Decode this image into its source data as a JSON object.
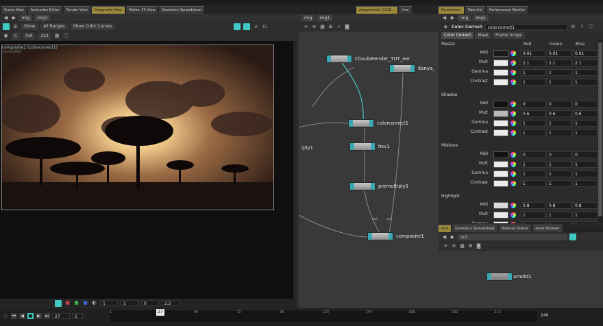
{
  "viewer": {
    "tabs": [
      "Scene View",
      "Animation Editor",
      "Render View",
      "Composite View",
      "Motion FX View",
      "Geometry Spreadsheet"
    ],
    "active_tab": 3,
    "path": "img1",
    "path_root": "img",
    "show_label": "Show",
    "range_label": "All Ranges",
    "channel": "C",
    "quality": "Full",
    "zoom_mode": "2x2",
    "curves_button": "Show Color Curves",
    "node_label": "composite1 (colorcorrect1)",
    "resolution": "1920x1080",
    "gamma_value": "1",
    "exposure_value": "1",
    "offset_value": "0",
    "display_gamma": "2.2"
  },
  "network": {
    "tabs": [
      "/shop/arnold_CLOU...",
      "/vex"
    ],
    "path_root": "img",
    "path": "img1",
    "nodes": [
      {
        "name": "CloudsRender_TUT_exr"
      },
      {
        "name": "Kenya_"
      },
      {
        "name": "colorcorrect1"
      },
      {
        "name": "hsv1"
      },
      {
        "name": "premultiply1"
      },
      {
        "name": "composite1"
      },
      {
        "name": "iply1"
      }
    ],
    "wire_labels": [
      "out",
      "out"
    ]
  },
  "params": {
    "tabs": [
      "Parameters",
      "Take List",
      "Performance Monitor"
    ],
    "path_root": "img",
    "path": "img1",
    "node_type": "Color Correct",
    "node_name": "colorcorrect1",
    "subtabs": [
      "Color Correct",
      "Mask",
      "Frame Scope"
    ],
    "columns": [
      "Red",
      "Green",
      "Blue"
    ],
    "groups": [
      {
        "name": "Master",
        "rows": [
          {
            "label": "Add",
            "swatch": "#1a1a1a",
            "values": [
              "0.01",
              "0.01",
              "0.01"
            ]
          },
          {
            "label": "Mult",
            "swatch": "#ececec",
            "values": [
              "2.1",
              "2.1",
              "2.1"
            ]
          },
          {
            "label": "Gamma",
            "swatch": "#ececec",
            "values": [
              "1",
              "1",
              "1"
            ]
          },
          {
            "label": "Contrast",
            "swatch": "#ececec",
            "values": [
              "1",
              "1",
              "1"
            ]
          }
        ]
      },
      {
        "name": "Shadow",
        "rows": [
          {
            "label": "Add",
            "swatch": "#111111",
            "values": [
              "0",
              "0",
              "0"
            ]
          },
          {
            "label": "Mult",
            "swatch": "#b8b8b8",
            "values": [
              "0.6",
              "0.6",
              "0.6"
            ]
          },
          {
            "label": "Gamma",
            "swatch": "#ececec",
            "values": [
              "1",
              "1",
              "1"
            ]
          },
          {
            "label": "Contrast",
            "swatch": "#ececec",
            "values": [
              "1",
              "1",
              "1"
            ]
          }
        ]
      },
      {
        "name": "Midtone",
        "rows": [
          {
            "label": "Add",
            "swatch": "#111111",
            "values": [
              "0",
              "0",
              "0"
            ]
          },
          {
            "label": "Mult",
            "swatch": "#ececec",
            "values": [
              "1",
              "1",
              "1"
            ]
          },
          {
            "label": "Gamma",
            "swatch": "#ececec",
            "values": [
              "1",
              "1",
              "1"
            ]
          },
          {
            "label": "Contrast",
            "swatch": "#ececec",
            "values": [
              "1",
              "1",
              "1"
            ]
          }
        ]
      },
      {
        "name": "Highlight",
        "rows": [
          {
            "label": "Add",
            "swatch": "#d8d8d8",
            "values": [
              "0.8",
              "0.8",
              "0.8"
            ]
          },
          {
            "label": "Mult",
            "swatch": "#ececec",
            "values": [
              "1",
              "1",
              "1"
            ]
          },
          {
            "label": "Gamma",
            "swatch": "#ececec",
            "values": [
              "1",
              "1",
              "1"
            ]
          },
          {
            "label": "Contrast",
            "swatch": "#ececec",
            "values": [
              "1",
              "1",
              "1"
            ]
          }
        ]
      }
    ],
    "footer_show": "Show",
    "footer_range": "All Ranges"
  },
  "outnet": {
    "tabs": [
      "/out",
      "Geometry Spreadsheet",
      "Material Palette",
      "Asset Browser"
    ],
    "path": "out",
    "node": "arnold1"
  },
  "timeline": {
    "current_frame": "27",
    "start_frame": "1",
    "end_frame": "240",
    "ticks": [
      "1",
      "27",
      "48",
      "72",
      "96",
      "120",
      "144",
      "168",
      "192",
      "216"
    ]
  },
  "colors": {
    "accent": "#3ec9c4",
    "active_tab": "#9c8a3c",
    "node_teal": "#3aa9b3",
    "wire": "#46c9c2"
  }
}
